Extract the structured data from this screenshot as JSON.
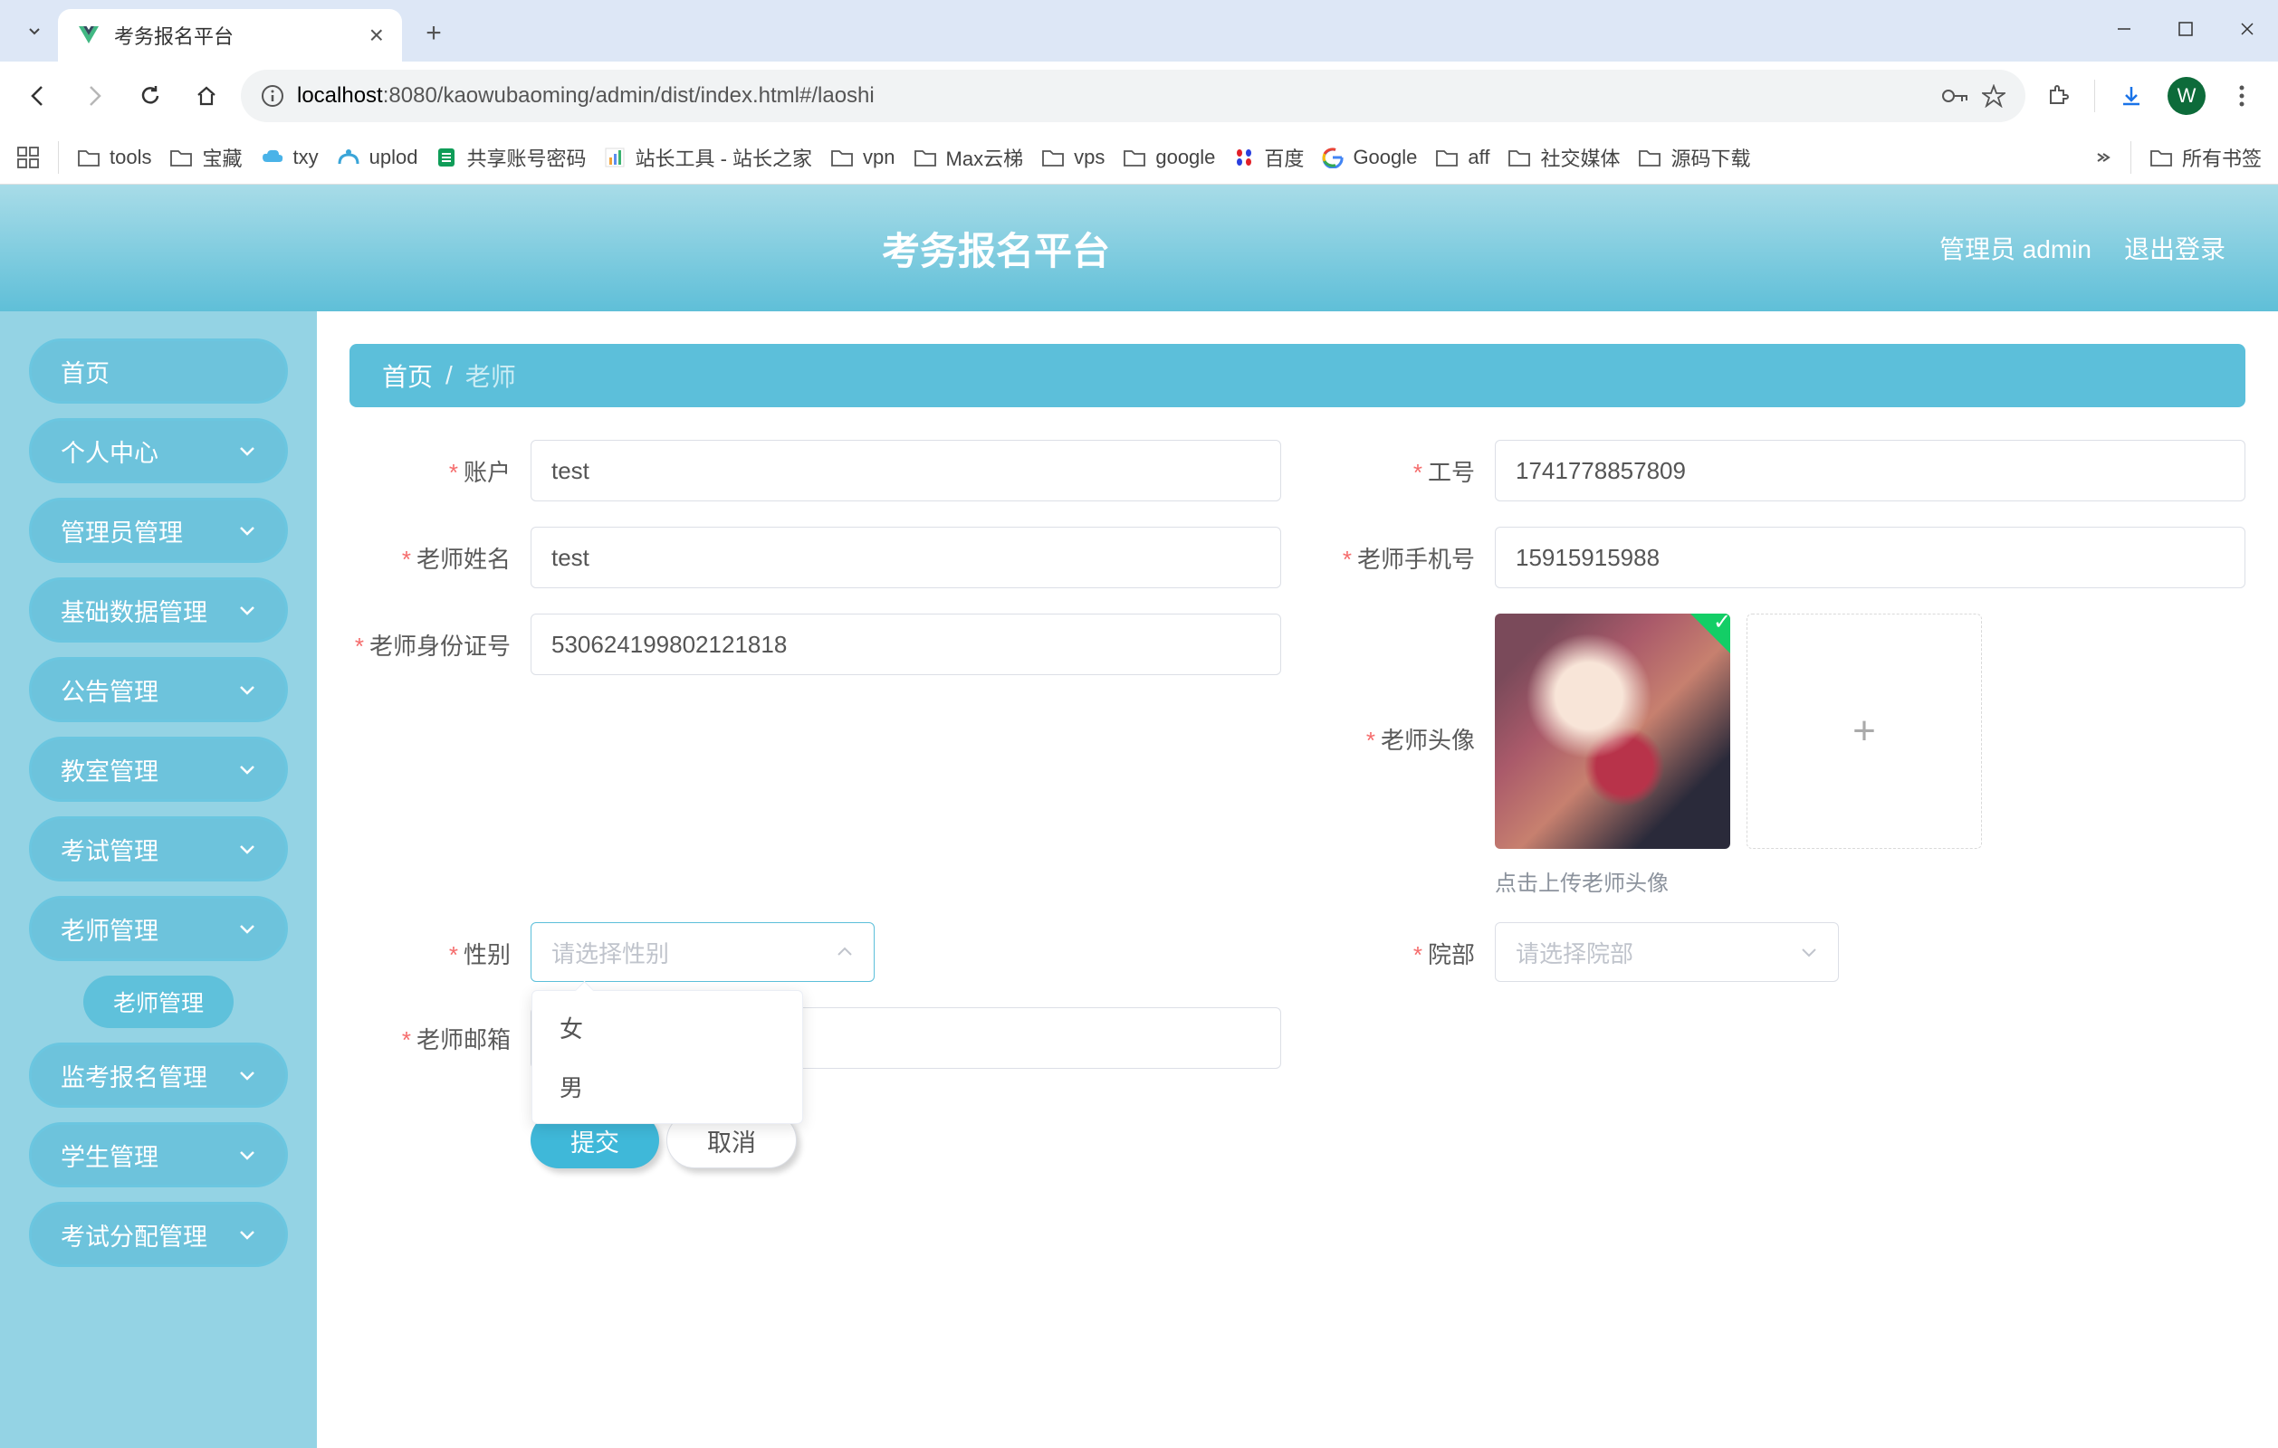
{
  "browser": {
    "tab_title": "考务报名平台",
    "url_host": "localhost",
    "url_path": ":8080/kaowubaoming/admin/dist/index.html#/laoshi",
    "profile_initial": "W"
  },
  "bookmarks": {
    "items": [
      {
        "label": "tools",
        "type": "folder"
      },
      {
        "label": "宝藏",
        "type": "folder"
      },
      {
        "label": "txy",
        "type": "icon",
        "icon": "txy"
      },
      {
        "label": "uplod",
        "type": "icon",
        "icon": "uplod"
      },
      {
        "label": "共享账号密码",
        "type": "icon",
        "icon": "sheets"
      },
      {
        "label": "站长工具 - 站长之家",
        "type": "icon",
        "icon": "zhanzhang"
      },
      {
        "label": "vpn",
        "type": "folder"
      },
      {
        "label": "Max云梯",
        "type": "folder"
      },
      {
        "label": "vps",
        "type": "folder"
      },
      {
        "label": "google",
        "type": "folder"
      },
      {
        "label": "百度",
        "type": "icon",
        "icon": "baidu"
      },
      {
        "label": "Google",
        "type": "icon",
        "icon": "google"
      },
      {
        "label": "aff",
        "type": "folder"
      },
      {
        "label": "社交媒体",
        "type": "folder"
      },
      {
        "label": "源码下载",
        "type": "folder"
      }
    ],
    "all_bookmarks": "所有书签"
  },
  "header": {
    "title": "考务报名平台",
    "user_label": "管理员 admin",
    "logout": "退出登录"
  },
  "sidebar": {
    "items": [
      {
        "label": "首页",
        "expandable": false
      },
      {
        "label": "个人中心",
        "expandable": true
      },
      {
        "label": "管理员管理",
        "expandable": true
      },
      {
        "label": "基础数据管理",
        "expandable": true
      },
      {
        "label": "公告管理",
        "expandable": true
      },
      {
        "label": "教室管理",
        "expandable": true
      },
      {
        "label": "考试管理",
        "expandable": true
      },
      {
        "label": "老师管理",
        "expandable": true,
        "active": true,
        "sub": [
          {
            "label": "老师管理"
          }
        ]
      },
      {
        "label": "监考报名管理",
        "expandable": true
      },
      {
        "label": "学生管理",
        "expandable": true
      },
      {
        "label": "考试分配管理",
        "expandable": true
      }
    ]
  },
  "breadcrumb": {
    "home": "首页",
    "current": "老师"
  },
  "form": {
    "account_label": "账户",
    "account_value": "test",
    "jobid_label": "工号",
    "jobid_value": "1741778857809",
    "name_label": "老师姓名",
    "name_value": "test",
    "phone_label": "老师手机号",
    "phone_value": "15915915988",
    "idcard_label": "老师身份证号",
    "idcard_value": "530624199802121818",
    "avatar_label": "老师头像",
    "avatar_hint": "点击上传老师头像",
    "gender_label": "性别",
    "gender_placeholder": "请选择性别",
    "gender_options": [
      "女",
      "男"
    ],
    "dept_label": "院部",
    "dept_placeholder": "请选择院部",
    "email_label": "老师邮箱",
    "email_value": "",
    "submit": "提交",
    "cancel": "取消"
  }
}
